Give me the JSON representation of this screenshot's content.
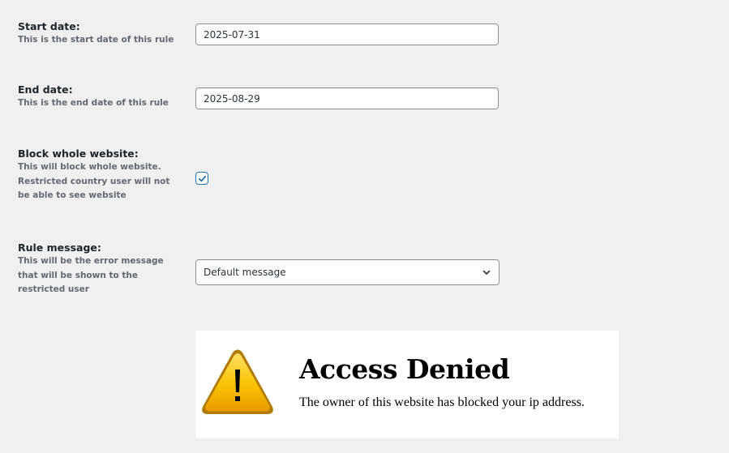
{
  "fields": {
    "start_date": {
      "title": "Start date:",
      "description": "This is the start date of this rule",
      "value": "2025-07-31"
    },
    "end_date": {
      "title": "End date:",
      "description": "This is the end date of this rule",
      "value": "2025-08-29"
    },
    "block_whole_website": {
      "title": "Block whole website:",
      "description": "This will block whole website.\nRestricted country user will not\nbe able to see website",
      "checked": true
    },
    "rule_message": {
      "title": "Rule message:",
      "description": "This will be the error message\nthat will be shown to the\nrestricted user",
      "selected": "Default message"
    }
  },
  "preview": {
    "title": "Access Denied",
    "message": "The owner of this website has blocked your ip address."
  },
  "colors": {
    "background": "#f0f0f1",
    "checkbox_accent": "#2271b1",
    "warning_yellow": "#f5c400"
  },
  "icons": {
    "checkbox": "checkmark-icon",
    "select": "chevron-down-icon",
    "preview": "warning-triangle-icon"
  }
}
